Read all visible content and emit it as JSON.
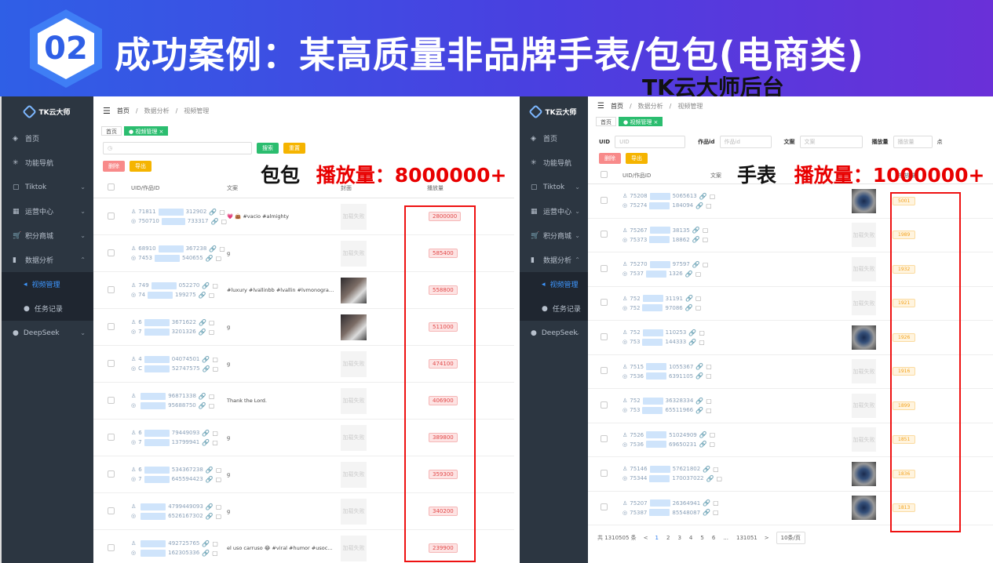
{
  "banner": {
    "number": "02",
    "title": "成功案例：某高质量非品牌手表/包包(电商类)",
    "subtitle": "TK云大师后台"
  },
  "app": {
    "logo": "TK云大师"
  },
  "left": {
    "breadcrumb": [
      "首页",
      "数据分析",
      "视频管理"
    ],
    "tabs": [
      "首页",
      "● 视频管理 ×"
    ],
    "search_button": "搜索",
    "reset_button": "重置",
    "delete_button": "删除",
    "export_button": "导出",
    "overlay_label": "包包",
    "overlay_metric": "播放量：8000000+",
    "headers": {
      "uid": "UID/作品ID",
      "text": "文案",
      "cover": "封面",
      "plays": "播放量"
    },
    "menu": [
      {
        "icon": "首",
        "label": "首页"
      },
      {
        "icon": "器",
        "label": "功能导航"
      },
      {
        "icon": "☐",
        "label": "Tiktok"
      },
      {
        "icon": "▦",
        "label": "运营中心"
      },
      {
        "icon": "🛒",
        "label": "积分商城"
      },
      {
        "icon": "▮",
        "label": "数据分析"
      }
    ],
    "submenu": [
      {
        "label": "视频管理"
      },
      {
        "label": "任务记录"
      }
    ],
    "menu_tail": {
      "label": "DeepSeek"
    },
    "rows": [
      {
        "uid1": "71811",
        "uid1b": "312902",
        "uid2": "750710",
        "uid2b": "733317",
        "text": "💗 👜 #vacio #almighty",
        "cover": "加载失败",
        "plays": "2800000"
      },
      {
        "uid1": "68910",
        "uid1b": "367238",
        "uid2": "7453",
        "uid2b": "540655",
        "text": "g",
        "cover": "加载失败",
        "plays": "585400"
      },
      {
        "uid1": "749",
        "uid1b": "052270",
        "uid2": "74",
        "uid2b": "199275",
        "text": "#luxury #lvallinbb #lvallin #lvmonogram...",
        "cover": "",
        "plays": "558800"
      },
      {
        "uid1": "6",
        "uid1b": "3671622",
        "uid2": "7",
        "uid2b": "3201326",
        "text": "g",
        "cover": "",
        "plays": "511000"
      },
      {
        "uid1": "4",
        "uid1b": "04074501",
        "uid2": "C",
        "uid2b": "52747575",
        "text": "g",
        "cover": "加载失败",
        "plays": "474100"
      },
      {
        "uid1": "",
        "uid1b": "96871338",
        "uid2": "",
        "uid2b": "95688750",
        "text": "Thank the Lord.",
        "cover": "加载失败",
        "plays": "406900"
      },
      {
        "uid1": "6",
        "uid1b": "79449093",
        "uid2": "7",
        "uid2b": "13799941",
        "text": "g",
        "cover": "加载失败",
        "plays": "389800"
      },
      {
        "uid1": "6",
        "uid1b": "534367238",
        "uid2": "7",
        "uid2b": "645594423",
        "text": "g",
        "cover": "加载失败",
        "plays": "359300"
      },
      {
        "uid1": "",
        "uid1b": "4799449093",
        "uid2": "",
        "uid2b": "6526167302",
        "text": "g",
        "cover": "加载失败",
        "plays": "340200"
      },
      {
        "uid1": "",
        "uid1b": "492725765",
        "uid2": "",
        "uid2b": "162305336",
        "text": "el uso carruso 😂 #viral #humor #usoc...",
        "cover": "加载失败",
        "plays": "239900"
      }
    ]
  },
  "right": {
    "breadcrumb": [
      "首页",
      "数据分析",
      "视频管理"
    ],
    "tabs": [
      "首页",
      "● 视频管理 ×"
    ],
    "filters": {
      "uid_label": "UID",
      "uid_ph": "UID",
      "work_label": "作品id",
      "work_ph": "作品id",
      "text_label": "文案",
      "text_ph": "文案",
      "plays_label": "播放量",
      "plays_ph": "播放量",
      "more": "点"
    },
    "delete_button": "删除",
    "export_button": "导出",
    "overlay_label": "手表",
    "overlay_metric": "播放量：1000000+",
    "headers": {
      "uid": "UID/作品ID",
      "text": "文案",
      "plays": "播放量"
    },
    "menu": [
      {
        "label": "首页"
      },
      {
        "label": "功能导航"
      },
      {
        "label": "Tiktok"
      },
      {
        "label": "运营中心"
      },
      {
        "label": "积分商城"
      },
      {
        "label": "数据分析"
      }
    ],
    "submenu": [
      {
        "label": "视频管理"
      },
      {
        "label": "任务记录"
      }
    ],
    "menu_tail": {
      "label": "DeepSeek"
    },
    "rows": [
      {
        "uid1": "75208",
        "uid1b": "5065613",
        "uid2": "75274",
        "uid2b": "184094",
        "cover": "",
        "plays": "5001"
      },
      {
        "uid1": "75267",
        "uid1b": "38135",
        "uid2": "75373",
        "uid2b": "18862",
        "cover": "加载失败",
        "plays": "1989"
      },
      {
        "uid1": "75270",
        "uid1b": "97597",
        "uid2": "7537",
        "uid2b": "1326",
        "cover": "加载失败",
        "plays": "1932"
      },
      {
        "uid1": "752",
        "uid1b": "31191",
        "uid2": "752",
        "uid2b": "97086",
        "cover": "加载失败",
        "plays": "1921"
      },
      {
        "uid1": "752",
        "uid1b": "110253",
        "uid2": "753",
        "uid2b": "144333",
        "cover": "",
        "plays": "1926"
      },
      {
        "uid1": "7515",
        "uid1b": "1055367",
        "uid2": "7536",
        "uid2b": "6391105",
        "cover": "加载失败",
        "plays": "1916"
      },
      {
        "uid1": "752",
        "uid1b": "36328334",
        "uid2": "753",
        "uid2b": "65511966",
        "cover": "加载失败",
        "plays": "1899"
      },
      {
        "uid1": "7526",
        "uid1b": "51024909",
        "uid2": "7536",
        "uid2b": "69650231",
        "cover": "加载失败",
        "plays": "1851"
      },
      {
        "uid1": "75146",
        "uid1b": "57621802",
        "uid2": "75344",
        "uid2b": "170037022",
        "cover": "",
        "plays": "1836"
      },
      {
        "uid1": "75207",
        "uid1b": "26364941",
        "uid2": "75387",
        "uid2b": "85548087",
        "cover": "",
        "plays": "1813"
      }
    ],
    "pager": {
      "total": "共 1310505 条",
      "prev": "<",
      "pages": [
        "1",
        "2",
        "3",
        "4",
        "5",
        "6",
        "...",
        "131051"
      ],
      "next": ">",
      "size": "10条/页"
    }
  }
}
